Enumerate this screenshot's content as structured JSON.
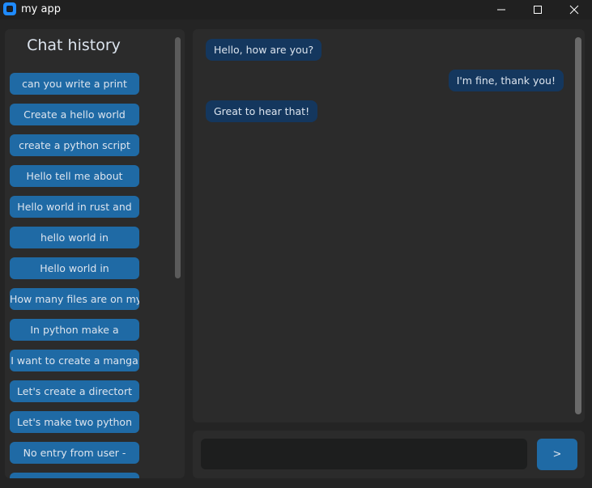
{
  "window": {
    "title": "my app"
  },
  "sidebar": {
    "title": "Chat history",
    "items": [
      {
        "label": "can you write a print"
      },
      {
        "label": "Create a hello world"
      },
      {
        "label": "create a python script"
      },
      {
        "label": "Hello tell me about"
      },
      {
        "label": "Hello world in rust and"
      },
      {
        "label": "hello world in"
      },
      {
        "label": "Hello world in"
      },
      {
        "label": "How many files are on my"
      },
      {
        "label": "In python make a"
      },
      {
        "label": "I want to create a manga"
      },
      {
        "label": "Let's create a directort"
      },
      {
        "label": "Let's make two python"
      },
      {
        "label": "No entry from user -"
      },
      {
        "label": ""
      }
    ]
  },
  "chat": {
    "messages": [
      {
        "sender": "user",
        "text": "Hello, how are you?"
      },
      {
        "sender": "assistant",
        "text": "I'm fine, thank you!"
      },
      {
        "sender": "user",
        "text": "Great to hear that!"
      }
    ]
  },
  "input": {
    "value": "",
    "placeholder": ""
  },
  "send": {
    "label": ">"
  },
  "colors": {
    "accent": "#1f6aa5",
    "bubble": "#14375e",
    "panel": "#2b2b2b",
    "background": "#242424",
    "titlebar": "#202020",
    "app_icon": "#1f8bff"
  },
  "icons": [
    "app-icon",
    "minimize-icon",
    "maximize-icon",
    "close-icon"
  ]
}
